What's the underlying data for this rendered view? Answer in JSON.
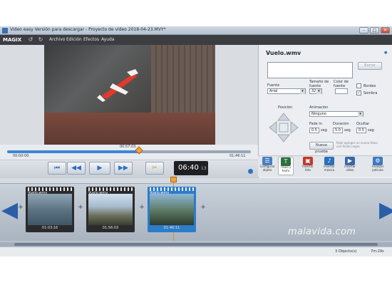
{
  "window": {
    "title": "Video easy Versión para descargar - Proyecto de vídeo 2018-04-23.MVY*",
    "min": "–",
    "max": "□",
    "close": "✕"
  },
  "menu": {
    "logo": "MAGIX",
    "items": [
      "Archivo",
      "Edición",
      "Efectos",
      "Ayuda"
    ],
    "undo": "↺",
    "redo": "↻"
  },
  "player": {
    "time_start": "00:00:00",
    "time_current": "00:57:03",
    "time_end": "01:46:11",
    "progress_fraction": 0.54,
    "timecode": "06:40",
    "frames": "13"
  },
  "panel": {
    "title": "Vuelo.wmv",
    "help": "●",
    "delete_label": "Borrar",
    "font_label": "Fuente",
    "font_value": "Arial",
    "size_label": "Tamaño de fuente",
    "size_value": "32",
    "color_label": "Color de fuente",
    "borders_label": "Bordes",
    "shadow_label": "Sombra",
    "shadow_checked": "✓",
    "position_label": "Posición",
    "animation_label": "Animación",
    "animation_value": "Ninguno",
    "fadein_label": "Fade in",
    "fadein_value": "0.5",
    "duration_label": "Duración",
    "duration_value": "5.0",
    "fadeout_label": "Ocultar",
    "fadeout_value": "0.5",
    "seg": "seg",
    "new_test_label": "Nueva prueba",
    "hint": "Pajel agregar un nuevo título con fondo negro"
  },
  "tabs": [
    {
      "label": "Configurar objeto",
      "icon": "☰",
      "color": "#4a7fbf"
    },
    {
      "label": "Título y texto",
      "icon": "T",
      "color": "#2f6f3c"
    },
    {
      "label": "Insertar foto",
      "icon": "▣",
      "color": "#c0392b"
    },
    {
      "label": "Insertar música",
      "icon": "♪",
      "color": "#2c6fb8"
    },
    {
      "label": "Insertar vídeo",
      "icon": "▶",
      "color": "#3a66a8"
    },
    {
      "label": "Finalizar película",
      "icon": "⚙",
      "color": "#3f79c0"
    }
  ],
  "clips": [
    {
      "name": "Vuelo.wmv",
      "duration": "01:03:16"
    },
    {
      "name": "Vuelo.wmv",
      "duration": "01:56:03"
    },
    {
      "name": "Vuelo.wmv",
      "duration": "01:46:11"
    }
  ],
  "status": {
    "objects": "3 Objecto(s)",
    "total": "7m:29s"
  },
  "watermark": "malavida.com"
}
